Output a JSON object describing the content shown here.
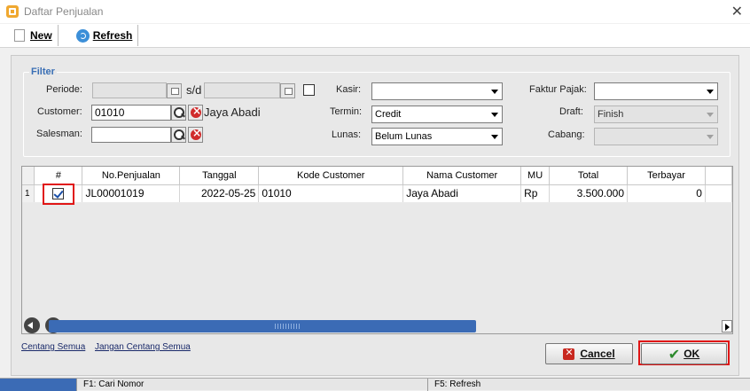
{
  "window": {
    "title": "Daftar Penjualan",
    "close_glyph": "✕"
  },
  "toolbar": {
    "new_label": "New",
    "refresh_label": "Refresh"
  },
  "filter": {
    "legend": "Filter",
    "periode_label": "Periode:",
    "sd_label": "s/d",
    "customer_label": "Customer:",
    "customer_code": "01010",
    "customer_name": "Jaya Abadi",
    "salesman_label": "Salesman:",
    "salesman_value": "",
    "kasir_label": "Kasir:",
    "kasir_value": "",
    "termin_label": "Termin:",
    "termin_value": "Credit",
    "lunas_label": "Lunas:",
    "lunas_value": "Belum Lunas",
    "faktur_label": "Faktur Pajak:",
    "faktur_value": "",
    "draft_label": "Draft:",
    "draft_value": "Finish",
    "cabang_label": "Cabang:",
    "cabang_value": ""
  },
  "grid": {
    "columns": [
      "#",
      "No.Penjualan",
      "Tanggal",
      "Kode Customer",
      "Nama Customer",
      "MU",
      "Total",
      "Terbayar"
    ],
    "rows": [
      {
        "row_no": "1",
        "checked": true,
        "no_penjualan": "JL00001019",
        "tanggal": "2022-05-25",
        "kode_customer": "01010",
        "nama_customer": "Jaya Abadi",
        "mu": "Rp",
        "total": "3.500.000",
        "terbayar": "0"
      }
    ]
  },
  "footer": {
    "check_all": "Centang Semua",
    "uncheck_all": "Jangan Centang Semua",
    "cancel_label": "Cancel",
    "ok_label": "OK"
  },
  "statusbar": {
    "f1": "F1: Cari Nomor",
    "f5": "F5: Refresh"
  },
  "colors": {
    "highlight": "#e01515",
    "accent": "#3b6bb5",
    "legend": "#3a6fb5"
  }
}
